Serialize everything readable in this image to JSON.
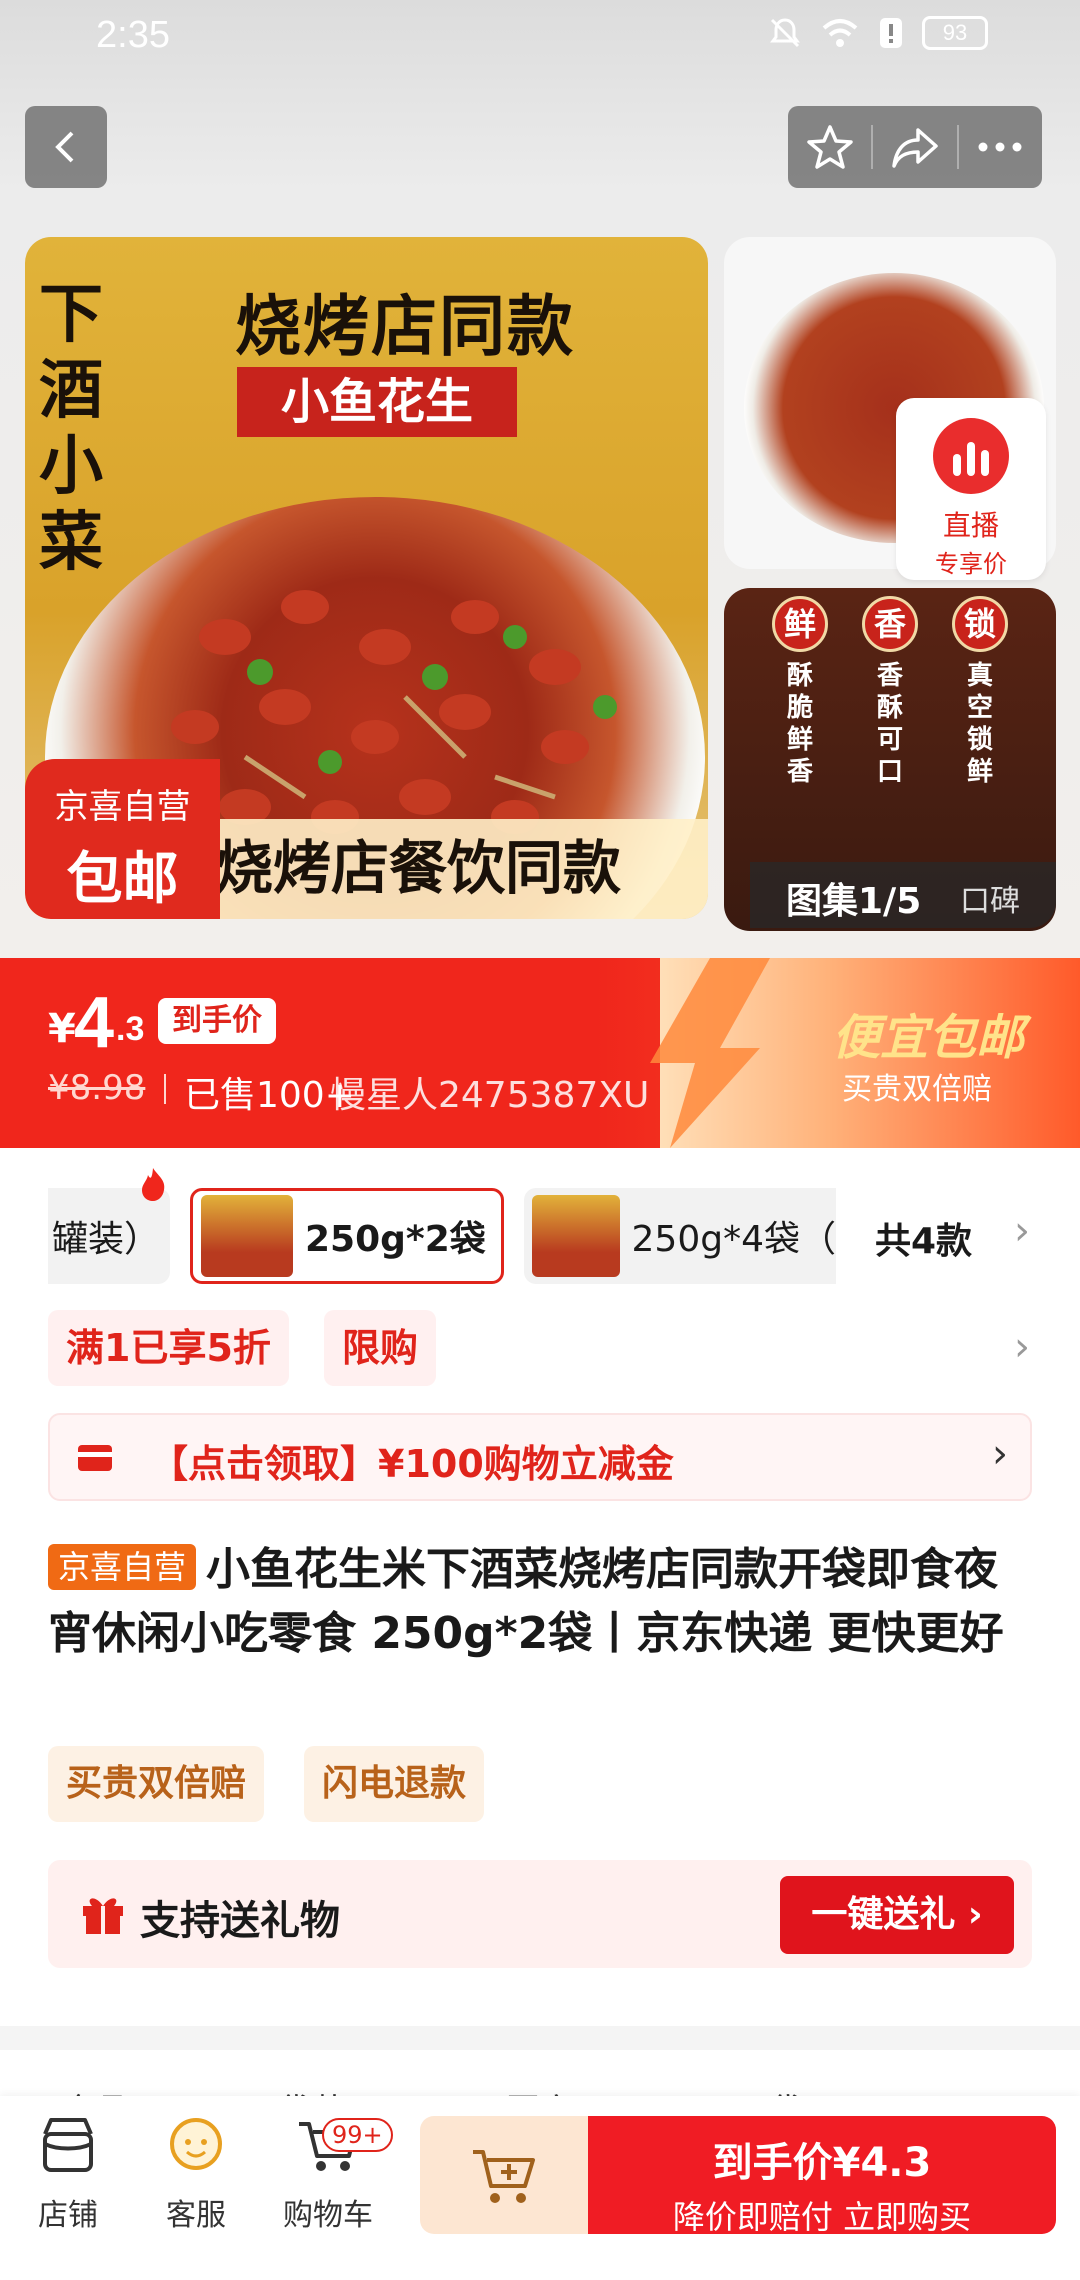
{
  "status_bar": {
    "time": "2:35",
    "battery": "93"
  },
  "gallery": {
    "main_image": {
      "side_title": "下酒小菜",
      "big_title": "烧烤店同款",
      "red_tag": "小鱼花生",
      "bottom_strip": "烧烤店餐饮同款",
      "badge_line1": "京喜自营",
      "badge_line2": "包邮"
    },
    "live_badge": {
      "line1": "直播",
      "line2": "专享价"
    },
    "thumb2_seals": [
      {
        "seal": "鲜",
        "text": "酥脆鲜香"
      },
      {
        "seal": "香",
        "text": "香酥可口"
      },
      {
        "seal": "锁",
        "text": "真空锁鲜"
      }
    ],
    "count_label": "图集1/5",
    "reviews_label": "口碑"
  },
  "price": {
    "yen": "¥",
    "integer": "4",
    "decimal": ".3",
    "tag": "到手价",
    "original": "¥8.98",
    "sold": "已售100+",
    "watermark": "慢星人2475387XU",
    "promo_title": "便宜包邮",
    "promo_sub": "买贵双倍赔"
  },
  "variants": {
    "items": [
      {
        "label": "罐装）",
        "active": false
      },
      {
        "label": "250g*2袋",
        "active": true
      },
      {
        "label": "250g*4袋（",
        "active": false
      }
    ],
    "total": "共4款"
  },
  "promos": [
    "满1已享5折",
    "限购"
  ],
  "coupon": {
    "text": "【点击领取】¥100购物立减金"
  },
  "product": {
    "badge": "京喜自营",
    "title": "小鱼花生米下酒菜烧烤店同款开袋即食夜宵休闲小吃零食 250g*2袋丨京东快递 更快更好"
  },
  "services": [
    "买贵双倍赔",
    "闪电退款"
  ],
  "gift": {
    "text": "支持送礼物",
    "button": "一键送礼 ›"
  },
  "specs": [
    "(全品",
    "袋装",
    "国产",
    "2袋"
  ],
  "bottom_bar": {
    "shop": "店铺",
    "service": "客服",
    "cart": "购物车",
    "cart_badge": "99+",
    "buy_line1": "到手价¥4.3",
    "buy_line2": "降价即赔付 立即购买"
  },
  "colors": {
    "accent_red": "#e0241b",
    "brand_orange": "#f06a14"
  }
}
